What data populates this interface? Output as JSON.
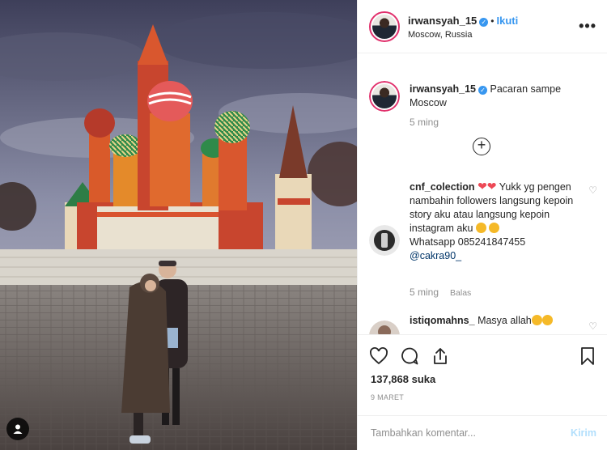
{
  "post": {
    "username": "irwansyah_15",
    "follow_label": "Ikuti",
    "dot": "•",
    "location": "Moscow, Russia",
    "more_label": "•••",
    "caption": "Pacaran sampe Moscow",
    "caption_time": "5 ming"
  },
  "comments": [
    {
      "username": "cnf_colection",
      "text_line1": "Yukk yg",
      "text_rest": "pengen nambahin followers langsung kepoin story aku atau langsung kepoin instagram aku",
      "whatsapp": "Whatsapp 085241847455",
      "mention": "@cakra90_",
      "time": "5 ming",
      "reply_label": "Balas"
    },
    {
      "username": "istiqomahns_",
      "text": "Masya allah"
    }
  ],
  "actions": {
    "likes": "137,868 suka",
    "date": "9 MARET",
    "comment_placeholder": "Tambahkan komentar...",
    "send_label": "Kirim"
  },
  "icons": {
    "verified": "verified-badge-icon",
    "like": "heart-outline-icon",
    "comment": "comment-bubble-icon",
    "share": "share-arrow-icon",
    "save": "bookmark-icon",
    "add": "plus-circle-icon",
    "user_tag": "user-tag-icon"
  },
  "colors": {
    "accent": "#3897f0",
    "heart": "#ed4956",
    "muted": "#8e8e8e"
  }
}
